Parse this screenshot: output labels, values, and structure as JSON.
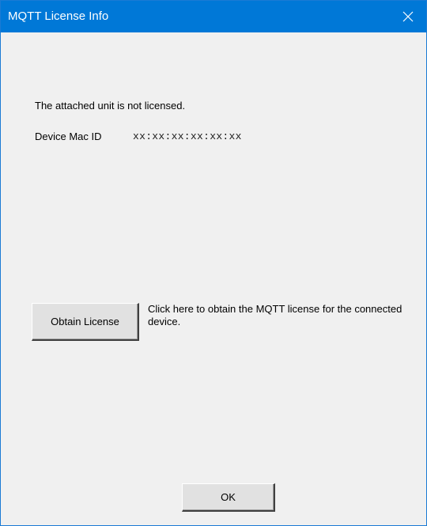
{
  "window": {
    "title": "MQTT License Info",
    "close_glyph": "close-icon"
  },
  "content": {
    "status_text": "The attached unit is not licensed.",
    "mac_label": "Device Mac ID",
    "mac_value": "xx:xx:xx:xx:xx:xx"
  },
  "license": {
    "button_label": "Obtain License",
    "description": "Click here to obtain the MQTT license for the connected device."
  },
  "footer": {
    "ok_label": "OK"
  },
  "colors": {
    "titlebar": "#0078d7",
    "window_bg": "#f0f0f0",
    "button_face": "#e1e1e1"
  }
}
